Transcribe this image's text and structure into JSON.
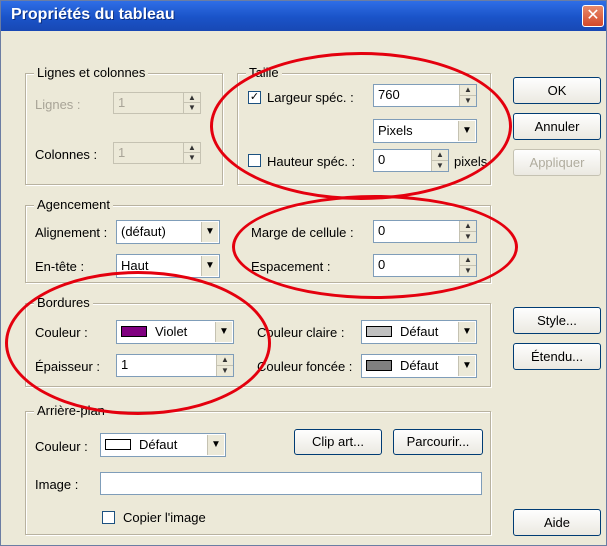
{
  "window": {
    "title": "Propriétés du tableau",
    "close_glyph": "✕"
  },
  "rows_cols": {
    "legend": "Lignes et colonnes",
    "rows_label": "Lignes :",
    "rows_value": "1",
    "cols_label": "Colonnes :",
    "cols_value": "1"
  },
  "size": {
    "legend": "Taille",
    "width_check": "✓",
    "width_label": "Largeur spéc. :",
    "width_value": "760",
    "unit_value": "Pixels",
    "height_label": "Hauteur spéc. :",
    "height_value": "0",
    "height_unit": "pixels"
  },
  "layout": {
    "legend": "Agencement",
    "align_label": "Alignement :",
    "align_value": "(défaut)",
    "header_label": "En-tête :",
    "header_value": "Haut",
    "padding_label": "Marge de cellule :",
    "padding_value": "0",
    "spacing_label": "Espacement :",
    "spacing_value": "0"
  },
  "borders": {
    "legend": "Bordures",
    "color_label": "Couleur :",
    "color_value": "Violet",
    "color_hex": "#800080",
    "thickness_label": "Épaisseur :",
    "thickness_value": "1",
    "light_label": "Couleur claire :",
    "light_value": "Défaut",
    "light_hex": "#c0c0c0",
    "dark_label": "Couleur foncée :",
    "dark_value": "Défaut",
    "dark_hex": "#808080"
  },
  "background": {
    "legend": "Arrière-plan",
    "color_label": "Couleur :",
    "color_value": "Défaut",
    "color_hex": "#ffffff",
    "clipart_label": "Clip art...",
    "browse_label": "Parcourir...",
    "image_label": "Image :",
    "image_value": "",
    "copy_label": "Copier l'image"
  },
  "buttons": {
    "ok": "OK",
    "cancel": "Annuler",
    "apply": "Appliquer",
    "style": "Style...",
    "extended": "Étendu...",
    "help": "Aide"
  },
  "annotation_color": "#e4000e"
}
